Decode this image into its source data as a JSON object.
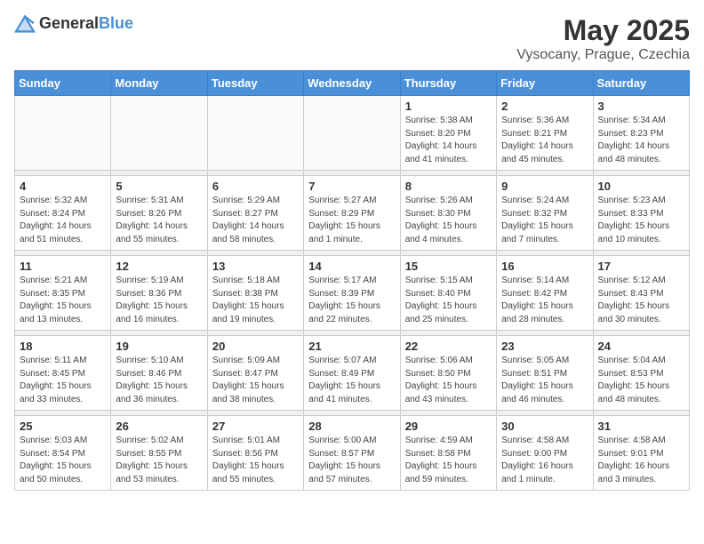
{
  "header": {
    "logo_general": "General",
    "logo_blue": "Blue",
    "month_title": "May 2025",
    "location": "Vysocany, Prague, Czechia"
  },
  "days_of_week": [
    "Sunday",
    "Monday",
    "Tuesday",
    "Wednesday",
    "Thursday",
    "Friday",
    "Saturday"
  ],
  "weeks": [
    {
      "days": [
        {
          "num": "",
          "info": ""
        },
        {
          "num": "",
          "info": ""
        },
        {
          "num": "",
          "info": ""
        },
        {
          "num": "",
          "info": ""
        },
        {
          "num": "1",
          "info": "Sunrise: 5:38 AM\nSunset: 8:20 PM\nDaylight: 14 hours\nand 41 minutes."
        },
        {
          "num": "2",
          "info": "Sunrise: 5:36 AM\nSunset: 8:21 PM\nDaylight: 14 hours\nand 45 minutes."
        },
        {
          "num": "3",
          "info": "Sunrise: 5:34 AM\nSunset: 8:23 PM\nDaylight: 14 hours\nand 48 minutes."
        }
      ]
    },
    {
      "days": [
        {
          "num": "4",
          "info": "Sunrise: 5:32 AM\nSunset: 8:24 PM\nDaylight: 14 hours\nand 51 minutes."
        },
        {
          "num": "5",
          "info": "Sunrise: 5:31 AM\nSunset: 8:26 PM\nDaylight: 14 hours\nand 55 minutes."
        },
        {
          "num": "6",
          "info": "Sunrise: 5:29 AM\nSunset: 8:27 PM\nDaylight: 14 hours\nand 58 minutes."
        },
        {
          "num": "7",
          "info": "Sunrise: 5:27 AM\nSunset: 8:29 PM\nDaylight: 15 hours\nand 1 minute."
        },
        {
          "num": "8",
          "info": "Sunrise: 5:26 AM\nSunset: 8:30 PM\nDaylight: 15 hours\nand 4 minutes."
        },
        {
          "num": "9",
          "info": "Sunrise: 5:24 AM\nSunset: 8:32 PM\nDaylight: 15 hours\nand 7 minutes."
        },
        {
          "num": "10",
          "info": "Sunrise: 5:23 AM\nSunset: 8:33 PM\nDaylight: 15 hours\nand 10 minutes."
        }
      ]
    },
    {
      "days": [
        {
          "num": "11",
          "info": "Sunrise: 5:21 AM\nSunset: 8:35 PM\nDaylight: 15 hours\nand 13 minutes."
        },
        {
          "num": "12",
          "info": "Sunrise: 5:19 AM\nSunset: 8:36 PM\nDaylight: 15 hours\nand 16 minutes."
        },
        {
          "num": "13",
          "info": "Sunrise: 5:18 AM\nSunset: 8:38 PM\nDaylight: 15 hours\nand 19 minutes."
        },
        {
          "num": "14",
          "info": "Sunrise: 5:17 AM\nSunset: 8:39 PM\nDaylight: 15 hours\nand 22 minutes."
        },
        {
          "num": "15",
          "info": "Sunrise: 5:15 AM\nSunset: 8:40 PM\nDaylight: 15 hours\nand 25 minutes."
        },
        {
          "num": "16",
          "info": "Sunrise: 5:14 AM\nSunset: 8:42 PM\nDaylight: 15 hours\nand 28 minutes."
        },
        {
          "num": "17",
          "info": "Sunrise: 5:12 AM\nSunset: 8:43 PM\nDaylight: 15 hours\nand 30 minutes."
        }
      ]
    },
    {
      "days": [
        {
          "num": "18",
          "info": "Sunrise: 5:11 AM\nSunset: 8:45 PM\nDaylight: 15 hours\nand 33 minutes."
        },
        {
          "num": "19",
          "info": "Sunrise: 5:10 AM\nSunset: 8:46 PM\nDaylight: 15 hours\nand 36 minutes."
        },
        {
          "num": "20",
          "info": "Sunrise: 5:09 AM\nSunset: 8:47 PM\nDaylight: 15 hours\nand 38 minutes."
        },
        {
          "num": "21",
          "info": "Sunrise: 5:07 AM\nSunset: 8:49 PM\nDaylight: 15 hours\nand 41 minutes."
        },
        {
          "num": "22",
          "info": "Sunrise: 5:06 AM\nSunset: 8:50 PM\nDaylight: 15 hours\nand 43 minutes."
        },
        {
          "num": "23",
          "info": "Sunrise: 5:05 AM\nSunset: 8:51 PM\nDaylight: 15 hours\nand 46 minutes."
        },
        {
          "num": "24",
          "info": "Sunrise: 5:04 AM\nSunset: 8:53 PM\nDaylight: 15 hours\nand 48 minutes."
        }
      ]
    },
    {
      "days": [
        {
          "num": "25",
          "info": "Sunrise: 5:03 AM\nSunset: 8:54 PM\nDaylight: 15 hours\nand 50 minutes."
        },
        {
          "num": "26",
          "info": "Sunrise: 5:02 AM\nSunset: 8:55 PM\nDaylight: 15 hours\nand 53 minutes."
        },
        {
          "num": "27",
          "info": "Sunrise: 5:01 AM\nSunset: 8:56 PM\nDaylight: 15 hours\nand 55 minutes."
        },
        {
          "num": "28",
          "info": "Sunrise: 5:00 AM\nSunset: 8:57 PM\nDaylight: 15 hours\nand 57 minutes."
        },
        {
          "num": "29",
          "info": "Sunrise: 4:59 AM\nSunset: 8:58 PM\nDaylight: 15 hours\nand 59 minutes."
        },
        {
          "num": "30",
          "info": "Sunrise: 4:58 AM\nSunset: 9:00 PM\nDaylight: 16 hours\nand 1 minute."
        },
        {
          "num": "31",
          "info": "Sunrise: 4:58 AM\nSunset: 9:01 PM\nDaylight: 16 hours\nand 3 minutes."
        }
      ]
    }
  ]
}
